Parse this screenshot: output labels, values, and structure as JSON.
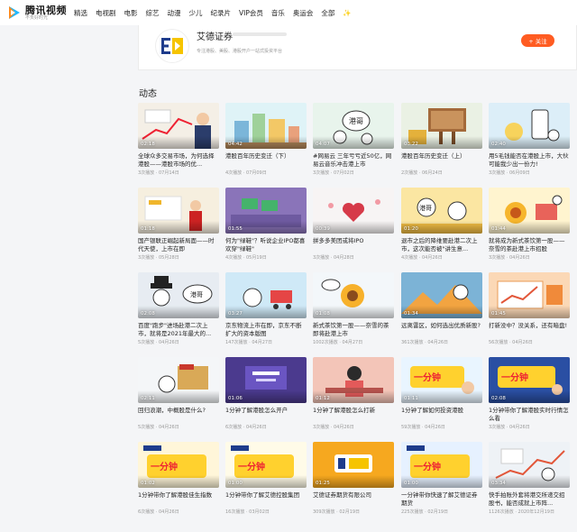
{
  "brand": {
    "name": "腾讯视频",
    "sub": "不负好时光"
  },
  "nav": [
    "精选",
    "电视剧",
    "电影",
    "综艺",
    "动漫",
    "少儿",
    "纪录片",
    "VIP会员",
    "音乐",
    "奥运会",
    "全部"
  ],
  "account": {
    "name": "艾德证券",
    "desc": "专注港股、美股、港股开户一站式投资平台",
    "follow_label": "+ 关注"
  },
  "section_title": "动态",
  "colors": {
    "accent": "#ff5c22",
    "text": "#222222",
    "meta": "#999999"
  },
  "videos": [
    {
      "title": "全球众多交易市场，为何选择港股——港股市场的优...",
      "duration": "02:18",
      "views": "3次播放",
      "date": "07月14日",
      "scene": "chart"
    },
    {
      "title": "港股百年历史变迁（下）",
      "duration": "04:42",
      "views": "4次播放",
      "date": "07月09日",
      "scene": "buildings"
    },
    {
      "title": "#网易云 三年亏亏近50亿，网易云音乐冲击港上市",
      "duration": "04:07",
      "views": "3次播放",
      "date": "07月02日",
      "scene": "chat"
    },
    {
      "title": "港股百年历史变迁（上）",
      "duration": "03:22",
      "views": "2次播放",
      "date": "06月24日",
      "scene": "board"
    },
    {
      "title": "用5毛钱能否在港股上市，大伙可能我少出一份力!",
      "duration": "02:40",
      "views": "3次播放",
      "date": "06月09日",
      "scene": "phone"
    },
    {
      "title": "国产银联正崛起新局面——时代天使，上市在即",
      "duration": "01:18",
      "views": "3次播放",
      "date": "05月28日",
      "scene": "presenter"
    },
    {
      "title": "何为\"绿鞋\"？听说企业IPO都喜欢穿\"绿鞋\"",
      "duration": "01:55",
      "views": "4次播放",
      "date": "05月19日",
      "scene": "green"
    },
    {
      "title": "拼多多美团或将IPO",
      "duration": "00:39",
      "views": "3次播放",
      "date": "04月28日",
      "scene": "hearts"
    },
    {
      "title": "退市之后的降维要赴港二次上市，这次能否被\"讲生意...",
      "duration": "01:20",
      "views": "4次播放",
      "date": "04月26日",
      "scene": "talk"
    },
    {
      "title": "就将成为新式茶饮第一股——奈雪的茶赴港上市招股",
      "duration": "01:44",
      "views": "3次播放",
      "date": "04月26日",
      "scene": "flowers"
    },
    {
      "title": "百度\"跑步\"进场赴港二次上市，就将是2021年最大的...",
      "duration": "02:08",
      "views": "5次播放",
      "date": "04月26日",
      "scene": "hat"
    },
    {
      "title": "京东物流上市在即，京东不断扩大的资本版图",
      "duration": "03:27",
      "views": "147次播放",
      "date": "04月27日",
      "scene": "logistics"
    },
    {
      "title": "新式茶饮第一股——奈雪的茶即将赴港上市",
      "duration": "01:08",
      "views": "1002次播放",
      "date": "04月27日",
      "scene": "sunflower"
    },
    {
      "title": "远离雷区，如何选出优质新股?",
      "duration": "01:34",
      "views": "361次播放",
      "date": "04月26日",
      "scene": "mountain"
    },
    {
      "title": "打新没中？没关系，还有暗盘!",
      "duration": "01:45",
      "views": "56次播放",
      "date": "04月26日",
      "scene": "orange"
    },
    {
      "title": "回归浪潮，中概股是什么?",
      "duration": "02:11",
      "views": "5次播放",
      "date": "04月26日",
      "scene": "cartoon"
    },
    {
      "title": "1分钟了解港股怎么开户",
      "duration": "01:06",
      "views": "6次播放",
      "date": "04月26日",
      "scene": "purple"
    },
    {
      "title": "1分钟了解港股怎么打新",
      "duration": "01:12",
      "views": "3次播放",
      "date": "04月26日",
      "scene": "woman"
    },
    {
      "title": "1分钟了解如何投资港股",
      "duration": "01:11",
      "views": "59次播放",
      "date": "04月26日",
      "scene": "yellow-banner"
    },
    {
      "title": "1分钟带你了解港股实时行情怎么看",
      "duration": "02:08",
      "views": "3次播放",
      "date": "04月26日",
      "scene": "blue-banner"
    },
    {
      "title": "1分钟带你了解港股佳生指数",
      "duration": "01:02",
      "views": "6次播放",
      "date": "04月26日",
      "scene": "promo-a"
    },
    {
      "title": "1分钟带你了解艾德控股集团",
      "duration": "01:00",
      "views": "16次播放",
      "date": "03月02日",
      "scene": "promo-b"
    },
    {
      "title": "艾德证券期货有限公司",
      "duration": "01:25",
      "views": "309次播放",
      "date": "02月19日",
      "scene": "eddid"
    },
    {
      "title": "一分钟带你快速了解艾德证券期货",
      "duration": "01:00",
      "views": "225次播放",
      "date": "02月19日",
      "scene": "promo-c"
    },
    {
      "title": "快手拍账外套将港交所递交招股书，能否成就上市阵...",
      "duration": "03:34",
      "views": "1126次播放",
      "date": "2020年12月19日",
      "scene": "kuaishou"
    }
  ]
}
